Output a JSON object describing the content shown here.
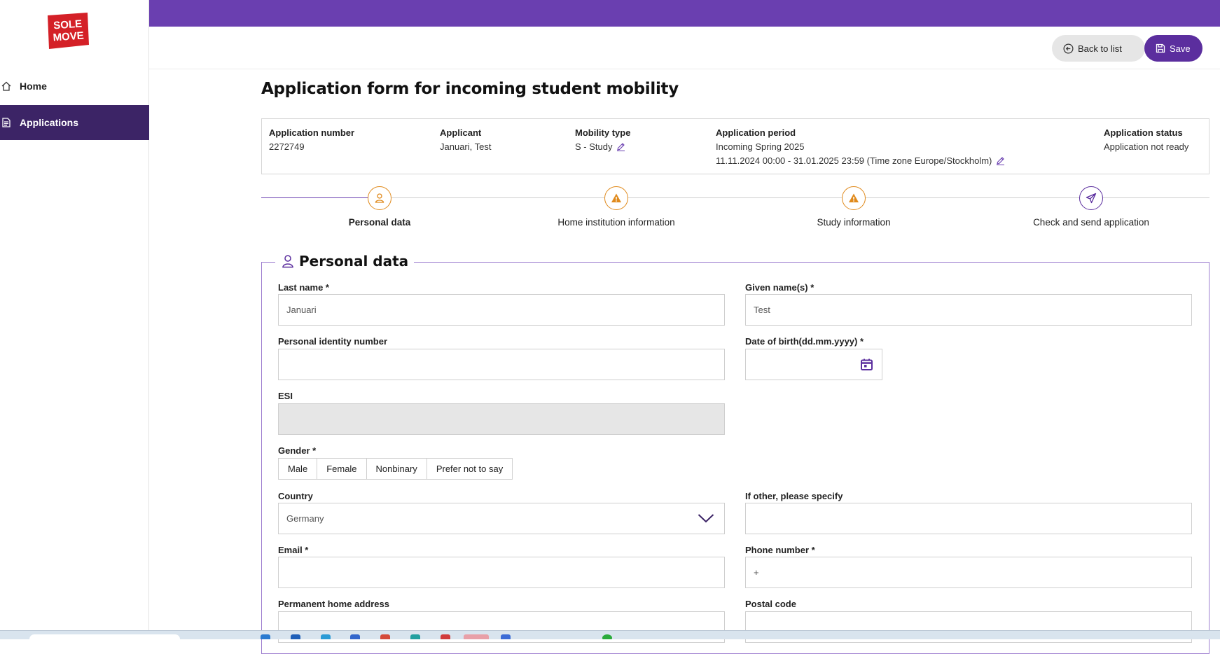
{
  "brand": {
    "logo_line1": "SOLE",
    "logo_line2": "MOVE",
    "logo_color": "#d42027"
  },
  "colors": {
    "primary": "#6a3fb0",
    "primary_dark": "#3c2466",
    "warning": "#e08a1c"
  },
  "sidebar": {
    "items": [
      {
        "label": "Home",
        "icon": "home-icon",
        "active": false
      },
      {
        "label": "Applications",
        "icon": "document-icon",
        "active": true
      }
    ]
  },
  "toolbar": {
    "back_label": "Back to list",
    "save_label": "Save"
  },
  "page": {
    "title": "Application form for incoming student mobility"
  },
  "summary": {
    "application_number": {
      "label": "Application number",
      "value": "2272749"
    },
    "applicant": {
      "label": "Applicant",
      "value": "Januari, Test"
    },
    "mobility_type": {
      "label": "Mobility type",
      "value": "S - Study"
    },
    "application_period": {
      "label": "Application period",
      "value": "Incoming Spring 2025",
      "range": "11.11.2024 00:00 - 31.01.2025 23:59 (Time zone Europe/Stockholm)"
    },
    "application_status": {
      "label": "Application status",
      "value": "Application not ready"
    }
  },
  "steps": [
    {
      "label": "Personal data",
      "icon": "person-icon",
      "active": true
    },
    {
      "label": "Home institution information",
      "icon": "warning-icon",
      "active": false
    },
    {
      "label": "Study information",
      "icon": "warning-icon",
      "active": false
    },
    {
      "label": "Check and send application",
      "icon": "send-icon",
      "active": false
    }
  ],
  "form": {
    "section_title": "Personal data",
    "last_name": {
      "label": "Last name *",
      "value": "Januari"
    },
    "given_names": {
      "label": "Given name(s) *",
      "value": "Test"
    },
    "personal_id": {
      "label": "Personal identity number",
      "value": ""
    },
    "dob": {
      "label": "Date of birth(dd.mm.yyyy) *",
      "value": ""
    },
    "esi": {
      "label": "ESI",
      "value": ""
    },
    "gender": {
      "label": "Gender *",
      "options": [
        "Male",
        "Female",
        "Nonbinary",
        "Prefer not to say"
      ]
    },
    "country": {
      "label": "Country",
      "value": "Germany"
    },
    "other_specify": {
      "label": "If other, please specify",
      "value": ""
    },
    "email": {
      "label": "Email *",
      "value": ""
    },
    "phone": {
      "label": "Phone number *",
      "value": "+"
    },
    "home_address": {
      "label": "Permanent home address",
      "value": ""
    },
    "postal_code": {
      "label": "Postal code",
      "value": ""
    }
  }
}
